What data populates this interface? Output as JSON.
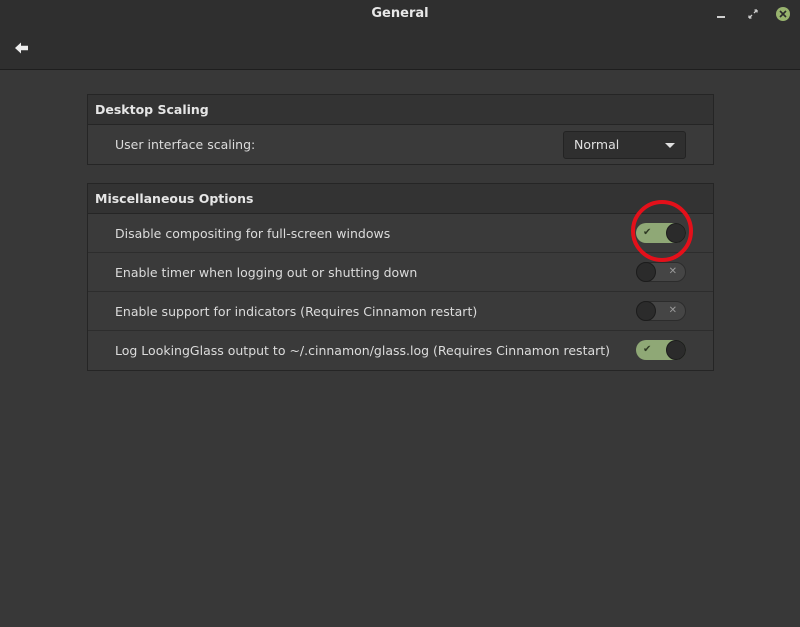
{
  "window": {
    "title": "General"
  },
  "sections": {
    "desktop_scaling": {
      "header": "Desktop Scaling",
      "ui_scaling_label": "User interface scaling:",
      "ui_scaling_value": "Normal"
    },
    "misc": {
      "header": "Miscellaneous Options",
      "items": [
        {
          "label": "Disable compositing for full-screen windows",
          "enabled": true
        },
        {
          "label": "Enable timer when logging out or shutting down",
          "enabled": false
        },
        {
          "label": "Enable support for indicators (Requires Cinnamon restart)",
          "enabled": false
        },
        {
          "label": "Log LookingGlass output to ~/.cinnamon/glass.log (Requires Cinnamon restart)",
          "enabled": true
        }
      ]
    }
  },
  "icons": {
    "back": "back-arrow-icon",
    "minimize": "minimize-icon",
    "maximize": "maximize-icon",
    "close": "close-icon",
    "toggle_on": "✔",
    "toggle_off": "✕"
  },
  "colors": {
    "accent": "#8fa876",
    "highlight": "#e4101a",
    "background": "#383838"
  }
}
